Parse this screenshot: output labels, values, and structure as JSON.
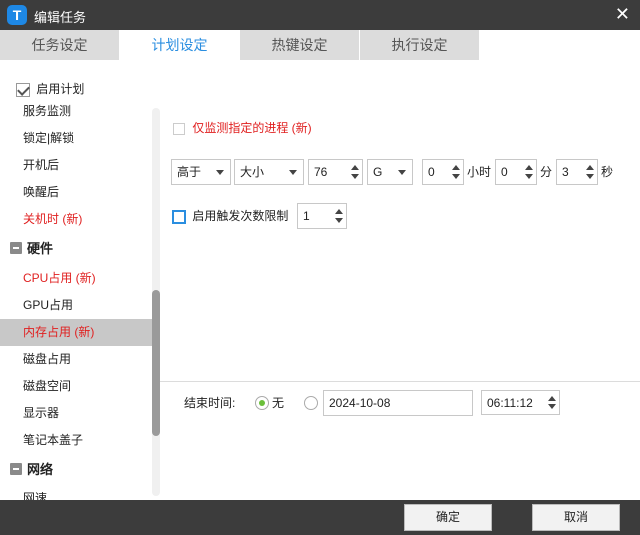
{
  "window": {
    "title": "编辑任务",
    "app_icon_letter": "T",
    "close_glyph": "✕"
  },
  "tabs": [
    {
      "label": "任务设定",
      "active": false
    },
    {
      "label": "计划设定",
      "active": true
    },
    {
      "label": "热键设定",
      "active": false
    },
    {
      "label": "执行设定",
      "active": false
    }
  ],
  "sidebar": {
    "enable_plan_label": "启用计划",
    "enable_plan_checked": true,
    "items_top": [
      "服务监测",
      "锁定|解锁",
      "开机后",
      "唤醒后"
    ],
    "shutdown_new": "关机时 (新)",
    "cat_hardware": "硬件",
    "cpu_new": "CPU占用 (新)",
    "gpu": "GPU占用",
    "mem_new": "内存占用 (新)",
    "disk_use": "磁盘占用",
    "disk_space": "磁盘空间",
    "display": "显示器",
    "laptop_lid": "笔记本盖子",
    "cat_network": "网络",
    "net_speed": "网速"
  },
  "main": {
    "only_process_label": "仅监测指定的进程 (新)",
    "compare_value": "高于",
    "metric_value": "大小",
    "amount_value": "76",
    "unit_value": "G",
    "hours_value": "0",
    "hours_label": "小时",
    "minutes_value": "0",
    "minutes_label": "分",
    "seconds_value": "3",
    "seconds_label": "秒",
    "limit_label": "启用触发次数限制",
    "limit_value": "1",
    "end_time_label": "结束时间:",
    "end_none_label": "无",
    "end_date_value": "2024-10-08",
    "end_time_value": "06:11:12"
  },
  "footer": {
    "ok_label": "确定",
    "cancel_label": "取消"
  },
  "colors": {
    "accent": "#2a8ee0",
    "new_red": "#e02020",
    "titlebar": "#3c3c3c",
    "radio_on": "#6bbf3a"
  }
}
